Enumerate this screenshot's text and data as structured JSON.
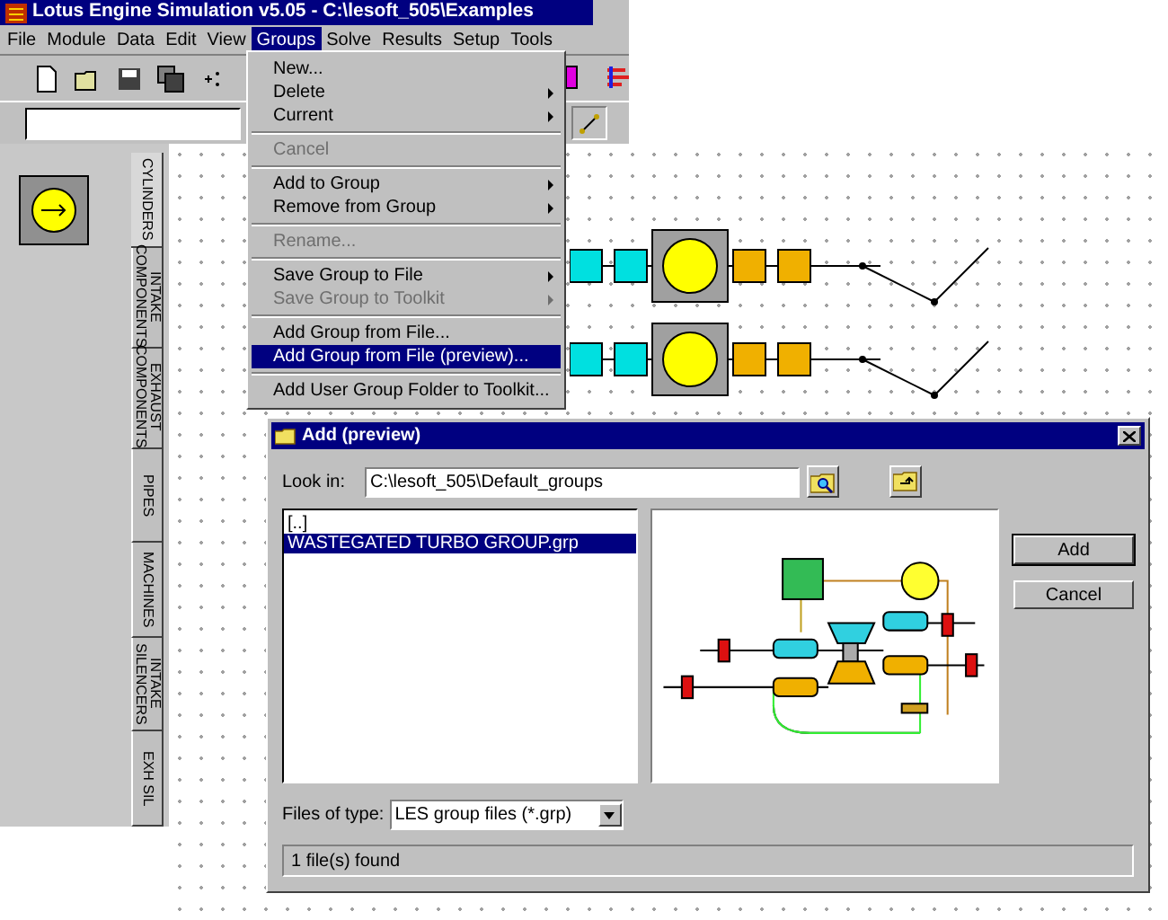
{
  "window": {
    "title": "Lotus Engine Simulation v5.05 - C:\\lesoft_505\\Examples"
  },
  "menu_bar": [
    {
      "label": "File",
      "selected": false
    },
    {
      "label": "Module",
      "selected": false
    },
    {
      "label": "Data",
      "selected": false
    },
    {
      "label": "Edit",
      "selected": false
    },
    {
      "label": "View",
      "selected": false
    },
    {
      "label": "Groups",
      "selected": true
    },
    {
      "label": "Solve",
      "selected": false
    },
    {
      "label": "Results",
      "selected": false
    },
    {
      "label": "Setup",
      "selected": false
    },
    {
      "label": "Tools",
      "selected": false
    }
  ],
  "groups_menu": [
    {
      "kind": "item",
      "label": "New...",
      "disabled": false,
      "submenu": false,
      "selected": false
    },
    {
      "kind": "item",
      "label": "Delete",
      "disabled": false,
      "submenu": true,
      "selected": false
    },
    {
      "kind": "item",
      "label": "Current",
      "disabled": false,
      "submenu": true,
      "selected": false
    },
    {
      "kind": "separator"
    },
    {
      "kind": "item",
      "label": "Cancel",
      "disabled": true,
      "submenu": false,
      "selected": false
    },
    {
      "kind": "separator"
    },
    {
      "kind": "item",
      "label": "Add to Group",
      "disabled": false,
      "submenu": true,
      "selected": false
    },
    {
      "kind": "item",
      "label": "Remove from Group",
      "disabled": false,
      "submenu": true,
      "selected": false
    },
    {
      "kind": "separator"
    },
    {
      "kind": "item",
      "label": "Rename...",
      "disabled": true,
      "submenu": false,
      "selected": false
    },
    {
      "kind": "separator"
    },
    {
      "kind": "item",
      "label": "Save Group to File",
      "disabled": false,
      "submenu": true,
      "selected": false
    },
    {
      "kind": "item",
      "label": "Save Group to Toolkit",
      "disabled": true,
      "submenu": true,
      "selected": false
    },
    {
      "kind": "separator"
    },
    {
      "kind": "item",
      "label": "Add Group from File...",
      "disabled": false,
      "submenu": false,
      "selected": false
    },
    {
      "kind": "item",
      "label": "Add Group from File (preview)...",
      "disabled": false,
      "submenu": false,
      "selected": true
    },
    {
      "kind": "separator"
    },
    {
      "kind": "item",
      "label": "Add User Group Folder to Toolkit...",
      "disabled": false,
      "submenu": false,
      "selected": false
    }
  ],
  "component_tabs": [
    {
      "label": "CYLINDERS",
      "selected": true
    },
    {
      "label": "INTAKE COMPONENTS",
      "selected": false
    },
    {
      "label": "EXHAUST COMPONENTS",
      "selected": false
    },
    {
      "label": "PIPES",
      "selected": false
    },
    {
      "label": "MACHINES",
      "selected": false
    },
    {
      "label": "INTAKE SILENCERS",
      "selected": false
    },
    {
      "label": "EXH SIL",
      "selected": false
    }
  ],
  "dialog": {
    "title": "Add (preview)",
    "look_in_label": "Look in:",
    "look_in_path": "C:\\lesoft_505\\Default_groups",
    "files": [
      {
        "name": "[..]",
        "selected": false
      },
      {
        "name": "WASTEGATED TURBO GROUP.grp",
        "selected": true
      }
    ],
    "buttons": [
      "Add",
      "Cancel"
    ],
    "files_of_type_label": "Files of type:",
    "files_of_type_value": "LES group files (*.grp)",
    "status": "1 file(s) found"
  }
}
